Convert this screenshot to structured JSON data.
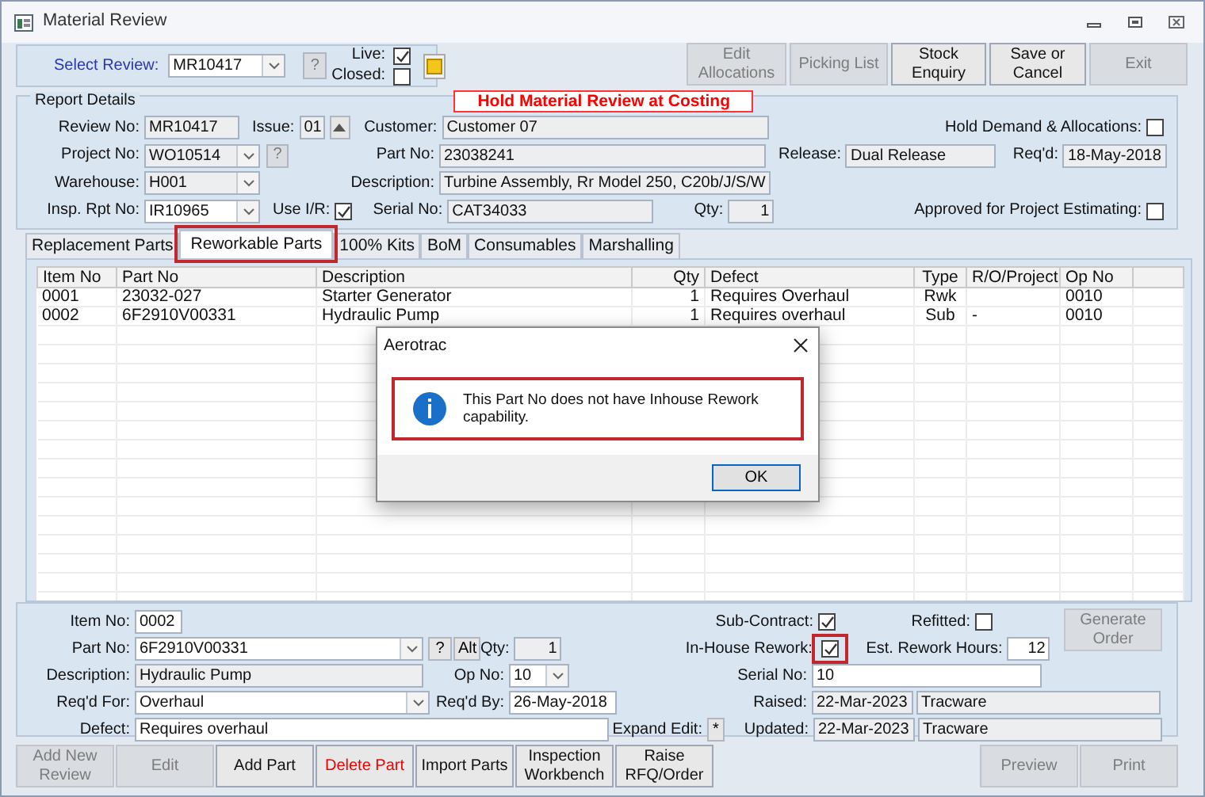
{
  "window": {
    "title": "Material Review"
  },
  "header": {
    "select_review": {
      "label": "Select Review:",
      "value": "MR10417"
    },
    "help_button": {
      "text": "?",
      "disabled": true
    },
    "live": {
      "label": "Live:",
      "checked": true
    },
    "closed": {
      "label": "Closed:",
      "checked": false
    }
  },
  "toolbar": [
    {
      "label": "Edit Allocations",
      "disabled": true
    },
    {
      "label": "Picking List",
      "disabled": true
    },
    {
      "label": "Stock Enquiry",
      "disabled": false
    },
    {
      "label": "Save or Cancel",
      "disabled": false
    },
    {
      "label": "Exit",
      "disabled": true
    }
  ],
  "report_details": {
    "title": "Report Details",
    "banner": "Hold Material Review at Costing",
    "lines": [
      {
        "fields": [
          {
            "kind": "text",
            "label": "Review No:",
            "value": "MR10417",
            "readonly": true
          },
          {
            "kind": "spin",
            "label": "Issue:",
            "value": "01"
          },
          {
            "kind": "text",
            "label": "Customer:",
            "value": "Customer 07",
            "readonly": true
          },
          {
            "kind": "check",
            "label": "Hold Demand & Allocations:",
            "checked": false
          }
        ]
      },
      {
        "fields": [
          {
            "kind": "combo",
            "label": "Project No:",
            "value": "WO10514",
            "readonly": true
          },
          {
            "kind": "button",
            "text": "?",
            "disabled": true
          },
          {
            "kind": "text",
            "label": "Part No:",
            "value": "23038241",
            "readonly": true
          },
          {
            "kind": "text",
            "label": "Release:",
            "value": "Dual Release",
            "readonly": true
          },
          {
            "kind": "text",
            "label": "Req'd:",
            "value": "18-May-2018",
            "readonly": true
          }
        ]
      },
      {
        "fields": [
          {
            "kind": "combo",
            "label": "Warehouse:",
            "value": "H001",
            "readonly": true
          },
          {
            "kind": "text",
            "label": "Description:",
            "value": "Turbine Assembly, Rr Model 250, C20b/J/S/W",
            "readonly": true
          }
        ]
      },
      {
        "fields": [
          {
            "kind": "combo",
            "label": "Insp. Rpt No:",
            "value": "IR10965",
            "readonly": false
          },
          {
            "kind": "check",
            "label": "Use I/R:",
            "checked": true
          },
          {
            "kind": "text",
            "label": "Serial No:",
            "value": "CAT34033",
            "readonly": true
          },
          {
            "kind": "text",
            "label": "Qty:",
            "value": "1",
            "readonly": true
          },
          {
            "kind": "check",
            "label": "Approved for Project Estimating:",
            "checked": false
          }
        ]
      }
    ]
  },
  "tabs": [
    {
      "label": "Replacement Parts",
      "selected": false,
      "highlighted": false
    },
    {
      "label": "Reworkable Parts",
      "selected": true,
      "highlighted": true
    },
    {
      "label": "100% Kits",
      "selected": false,
      "highlighted": false
    },
    {
      "label": "BoM",
      "selected": false,
      "highlighted": false
    },
    {
      "label": "Consumables",
      "selected": false,
      "highlighted": false
    },
    {
      "label": "Marshalling",
      "selected": false,
      "highlighted": false
    }
  ],
  "table": {
    "columns": [
      "Item No",
      "Part No",
      "Description",
      "Qty",
      "Defect",
      "Type",
      "R/O/Project",
      "Op No"
    ],
    "rows": [
      {
        "item_no": "0001",
        "part_no": "23032-027",
        "description": "Starter Generator",
        "qty": "1",
        "defect": "Requires Overhaul",
        "type": "Rwk",
        "op_no": "0010"
      },
      {
        "item_no": "0002",
        "part_no": "6F2910V00331",
        "description": "Hydraulic Pump",
        "qty": "1",
        "defect": "Requires overhaul",
        "type": "Sub",
        "ro_project": "-",
        "op_no": "0010"
      }
    ]
  },
  "detail": {
    "lines": [
      {
        "fields": [
          {
            "kind": "text",
            "label": "Item No:",
            "value": "0002",
            "readonly": false
          },
          {
            "kind": "check",
            "label": "Sub-Contract:",
            "checked": true,
            "highlighted": false
          },
          {
            "kind": "check",
            "label": "Refitted:",
            "checked": false,
            "highlighted": false
          }
        ]
      },
      {
        "fields": [
          {
            "kind": "combo",
            "label": "Part No:",
            "value": "6F2910V00331",
            "readonly": false
          },
          {
            "kind": "button",
            "text": "?",
            "disabled": false
          },
          {
            "kind": "button",
            "text": "Alt",
            "disabled": false
          },
          {
            "kind": "text",
            "label": "Qty:",
            "value": "1",
            "readonly": true
          },
          {
            "kind": "check",
            "label": "In-House Rework:",
            "checked": true,
            "highlighted": true
          },
          {
            "kind": "text",
            "label": "Est. Rework Hours:",
            "value": "12",
            "readonly": false
          }
        ]
      },
      {
        "fields": [
          {
            "kind": "text",
            "label": "Description:",
            "value": "Hydraulic Pump",
            "readonly": true
          },
          {
            "kind": "combo",
            "label": "Op No:",
            "value": "10",
            "readonly": false
          },
          {
            "kind": "text",
            "label": "Serial No:",
            "value": "10",
            "readonly": false
          }
        ]
      },
      {
        "fields": [
          {
            "kind": "combo",
            "label": "Req'd For:",
            "value": "Overhaul",
            "readonly": false
          },
          {
            "kind": "text",
            "label": "Req'd By:",
            "value": "26-May-2018",
            "readonly": false
          },
          {
            "kind": "text",
            "label": "Raised:",
            "value": "22-Mar-2023",
            "readonly": true
          },
          {
            "kind": "text",
            "value": "Tracware",
            "readonly": true
          }
        ]
      },
      {
        "fields": [
          {
            "kind": "text",
            "label": "Defect:",
            "value": "Requires overhaul",
            "readonly": false
          },
          {
            "kind": "button",
            "label": "Expand Edit:",
            "text": "*",
            "disabled": false
          },
          {
            "kind": "text",
            "label": "Updated:",
            "value": "22-Mar-2023",
            "readonly": true
          },
          {
            "kind": "text",
            "value": "Tracware",
            "readonly": true
          }
        ]
      }
    ],
    "generate_button": {
      "label": "Generate Order",
      "disabled": true
    }
  },
  "bottom_buttons_left": [
    {
      "label": "Add New Review",
      "disabled": true,
      "kind": "normal"
    },
    {
      "label": "Edit",
      "disabled": true,
      "kind": "normal"
    },
    {
      "label": "Add Part",
      "disabled": false,
      "kind": "normal"
    },
    {
      "label": "Delete Part",
      "disabled": false,
      "kind": "danger"
    },
    {
      "label": "Import Parts",
      "disabled": false,
      "kind": "normal"
    },
    {
      "label": "Inspection Workbench",
      "disabled": false,
      "kind": "normal"
    },
    {
      "label": "Raise RFQ/Order",
      "disabled": false,
      "kind": "normal"
    }
  ],
  "bottom_buttons_right": [
    {
      "label": "Preview",
      "disabled": true
    },
    {
      "label": "Print",
      "disabled": true
    }
  ],
  "dialog": {
    "title": "Aerotrac",
    "message": "This Part No does not have Inhouse Rework capability.",
    "highlighted": true,
    "ok_button": "OK"
  }
}
